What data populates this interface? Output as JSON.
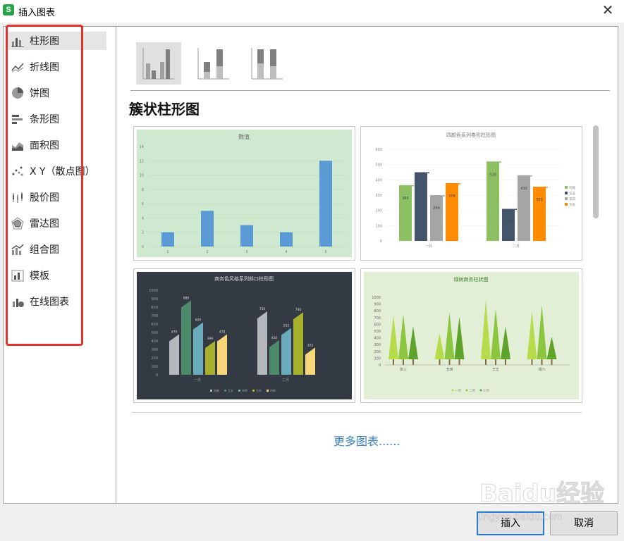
{
  "window": {
    "title": "插入图表",
    "icon_letter": "S"
  },
  "sidebar": {
    "items": [
      {
        "label": "柱形图",
        "icon": "column-chart-icon"
      },
      {
        "label": "折线图",
        "icon": "line-chart-icon"
      },
      {
        "label": "饼图",
        "icon": "pie-chart-icon"
      },
      {
        "label": "条形图",
        "icon": "bar-chart-icon"
      },
      {
        "label": "面积图",
        "icon": "area-chart-icon"
      },
      {
        "label": "X Y（散点图）",
        "icon": "scatter-chart-icon"
      },
      {
        "label": "股价图",
        "icon": "stock-chart-icon"
      },
      {
        "label": "雷达图",
        "icon": "radar-chart-icon"
      },
      {
        "label": "组合图",
        "icon": "combo-chart-icon"
      },
      {
        "label": "模板",
        "icon": "template-icon"
      },
      {
        "label": "在线图表",
        "icon": "online-chart-icon"
      }
    ],
    "selected_index": 0
  },
  "main": {
    "section_title": "簇状柱形图",
    "more_link": "更多图表......",
    "thumbnails": [
      {
        "title": "数值",
        "bg": "#cfe8d0",
        "bar_color": "#5b9bd5",
        "y_ticks": [
          "0",
          "2",
          "4",
          "6",
          "8",
          "10",
          "12",
          "14"
        ],
        "x_ticks": [
          "1",
          "2",
          "3",
          "4",
          "5"
        ],
        "values": [
          2,
          5,
          3,
          2,
          12
        ]
      },
      {
        "title": "四颜色系列卷形柱形图",
        "y_ticks": [
          "0",
          "100",
          "200",
          "300",
          "400",
          "500",
          "600"
        ],
        "groups": [
          "一月",
          "二月"
        ],
        "series": [
          {
            "name": "刘能",
            "color": "#8dc063",
            "values": [
              365,
              520
            ]
          },
          {
            "name": "王五",
            "color": "#44546a",
            "values": [
              450,
              210
            ]
          },
          {
            "name": "李四",
            "color": "#a5a5a5",
            "values": [
              299,
              430
            ]
          },
          {
            "name": "方东",
            "color": "#ff8c00",
            "values": [
              378,
              355
            ]
          }
        ],
        "labels": [
          [
            "365",
            "",
            "299",
            "378"
          ],
          [
            "520",
            "210",
            "430",
            "355"
          ]
        ]
      },
      {
        "title": "商务色风格系列斜口柱形图",
        "bg": "#333a44",
        "y_ticks": [
          "0",
          "100",
          "200",
          "300",
          "400",
          "500",
          "600",
          "700",
          "800",
          "900",
          "1000"
        ],
        "groups": [
          "一月",
          "二月"
        ],
        "series": [
          {
            "name": "刘能",
            "color": "#b4b8bd",
            "values": [
              479,
              750
            ]
          },
          {
            "name": "王五",
            "color": "#4c8a6a",
            "values": [
              880,
              410
            ]
          },
          {
            "name": "李四",
            "color": "#6aacbb",
            "values": [
              620,
              553
            ]
          },
          {
            "name": "方东",
            "color": "#a8b12c",
            "values": [
              399,
              740
            ]
          },
          {
            "name": "何新",
            "color": "#f8d67a",
            "values": [
              478,
              322
            ]
          }
        ]
      },
      {
        "title": "绿树商务柱状图",
        "bg": "#e2efd6",
        "y_ticks": [
          "0",
          "100",
          "200",
          "300",
          "400",
          "500",
          "600",
          "700",
          "800",
          "900",
          "1000"
        ],
        "x_ticks": [
          "张三",
          "李四",
          "王五",
          "钱六"
        ],
        "legend": [
          "一月",
          "二月",
          "三月"
        ]
      }
    ]
  },
  "buttons": {
    "insert": "插入",
    "cancel": "取消"
  },
  "watermark": {
    "brand": "Baidu经验",
    "url": "jingyan.baidu.com"
  }
}
